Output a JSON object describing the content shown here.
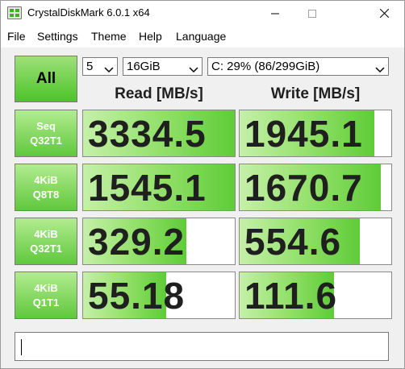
{
  "window": {
    "title": "CrystalDiskMark 6.0.1 x64",
    "icon": "crystaldiskmark-icon",
    "controls": [
      "minimize",
      "maximize",
      "close"
    ]
  },
  "menu": {
    "items": [
      "File",
      "Settings",
      "Theme",
      "Help",
      "Language"
    ]
  },
  "toolbar": {
    "all_label": "All",
    "count": "5",
    "size": "16GiB",
    "drive": "C: 29% (86/299GiB)"
  },
  "headers": {
    "read": "Read [MB/s]",
    "write": "Write [MB/s]"
  },
  "tests": [
    {
      "line1": "Seq",
      "line2": "Q32T1",
      "read": "3334.5",
      "write": "1945.1",
      "read_fill": 1.0,
      "write_fill": 0.89
    },
    {
      "line1": "4KiB",
      "line2": "Q8T8",
      "read": "1545.1",
      "write": "1670.7",
      "read_fill": 1.0,
      "write_fill": 0.93
    },
    {
      "line1": "4KiB",
      "line2": "Q32T1",
      "read": "329.2",
      "write": "554.6",
      "read_fill": 0.68,
      "write_fill": 0.79
    },
    {
      "line1": "4KiB",
      "line2": "Q1T1",
      "read": "55.18",
      "write": "111.6",
      "read_fill": 0.55,
      "write_fill": 0.62
    }
  ],
  "comment": {
    "value": ""
  },
  "colors": {
    "bar_green": "#5fcc38",
    "label_green": "#5fc83c"
  }
}
